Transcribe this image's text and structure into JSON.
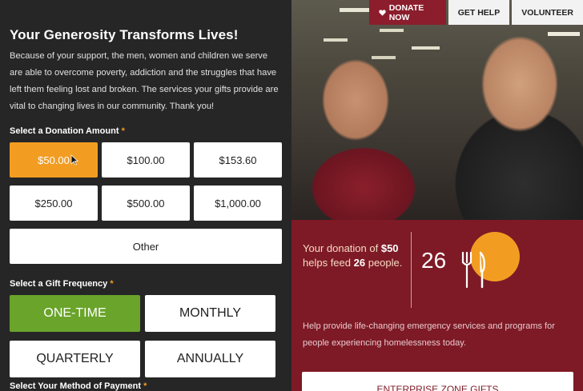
{
  "heading": "Your Generosity Transforms Lives!",
  "intro": "Because of your support, the men, women and children we serve are able to overcome poverty, addiction and the struggles that have left them feeling lost and broken. The services your gifts provide are vital to changing lives in our community. Thank you!",
  "amount_section": {
    "label": "Select a Donation Amount",
    "required_mark": "*"
  },
  "amounts": [
    "$50.00",
    "$100.00",
    "$153.60",
    "$250.00",
    "$500.00",
    "$1,000.00"
  ],
  "selected_amount": "$50.00",
  "other_label": "Other",
  "frequency_section": {
    "label": "Select a Gift Frequency",
    "required_mark": "*"
  },
  "frequencies": [
    "ONE-TIME",
    "MONTHLY",
    "QUARTERLY",
    "ANNUALLY"
  ],
  "selected_frequency": "ONE-TIME",
  "payment_section": {
    "label": "Select Your Method of Payment",
    "required_mark": "*"
  },
  "nav": {
    "donate": "DONATE NOW",
    "get_help": "GET HELP",
    "volunteer": "VOLUNTEER"
  },
  "impact": {
    "prefix": "Your donation of",
    "amount": "$50",
    "middle": "helps feed",
    "people": "26",
    "suffix": "people.",
    "count": "26"
  },
  "help_text": "Help provide life-changing emergency services and programs for people experiencing homelessness today.",
  "enterprise_button": "ENTERPRISE ZONE GIFTS",
  "colors": {
    "accent_orange": "#f29d22",
    "selected_green": "#6aa42a",
    "brand_maroon": "#7d1a26",
    "dark_bg": "#262626"
  }
}
